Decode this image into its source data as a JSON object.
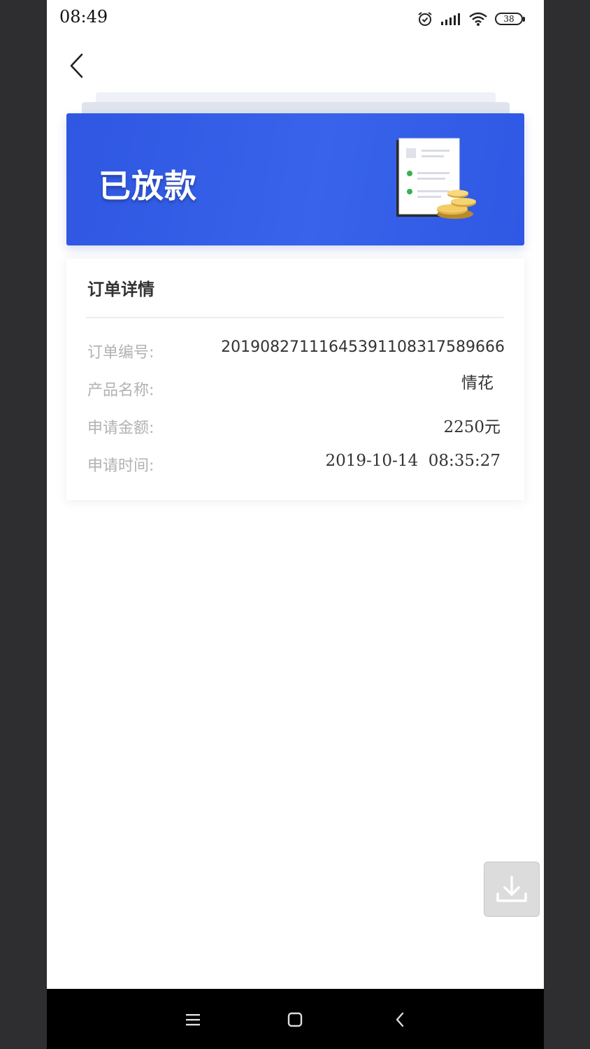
{
  "status_bar": {
    "time": "08:49",
    "battery": "38",
    "icons": [
      "alarm-icon",
      "signal-icon",
      "wifi-icon",
      "battery-icon"
    ]
  },
  "header": {
    "back_icon": "chevron-left-icon"
  },
  "banner": {
    "title": "已放款",
    "illustration": "document-with-coins-icon",
    "color": "#3562e8"
  },
  "order_details": {
    "title": "订单详情",
    "rows": [
      {
        "label": "订单编号:",
        "value": "20190827111645391108317589666"
      },
      {
        "label": "产品名称:",
        "value": "情花"
      },
      {
        "label": "申请金额:",
        "value": "2250元"
      },
      {
        "label": "申请时间:",
        "value": "2019-10-14  08:35:27"
      }
    ]
  },
  "floating": {
    "download_icon": "download-icon"
  },
  "nav_bar": {
    "icons": [
      "menu-icon",
      "home-icon",
      "back-icon"
    ]
  }
}
